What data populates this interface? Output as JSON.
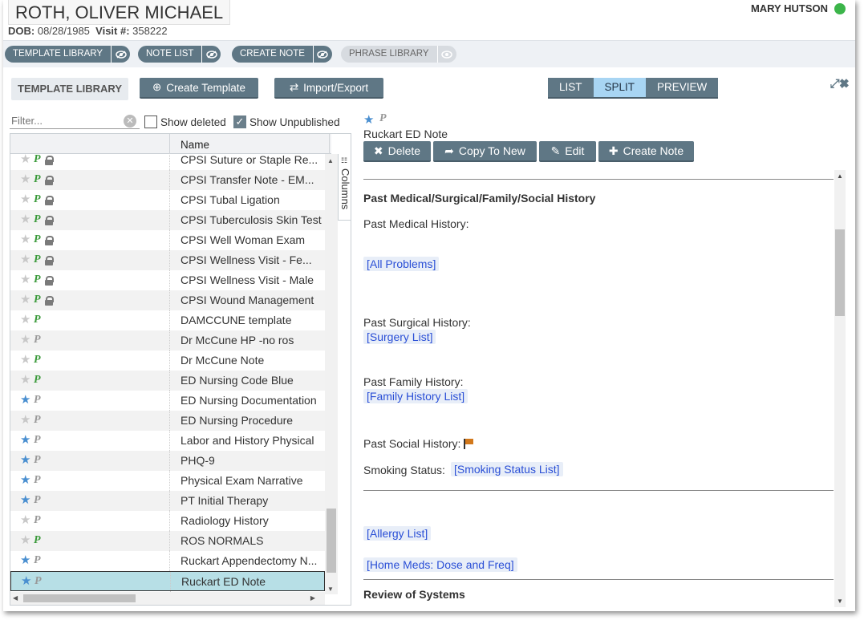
{
  "patient": {
    "name": "ROTH, OLIVER MICHAEL",
    "dob_label": "DOB:",
    "dob": "08/28/1985",
    "visit_label": "Visit #:",
    "visit": "358222"
  },
  "user": {
    "name": "MARY HUTSON",
    "status_color": "#3cb54a"
  },
  "nav_tabs": [
    {
      "label": "TEMPLATE LIBRARY",
      "enabled": true
    },
    {
      "label": "NOTE LIST",
      "enabled": true
    },
    {
      "label": "CREATE NOTE",
      "enabled": true
    },
    {
      "label": "PHRASE LIBRARY",
      "enabled": false
    }
  ],
  "toolbar": {
    "section_label": "TEMPLATE LIBRARY",
    "create_label": "Create Template",
    "import_label": "Import/Export",
    "views": [
      "LIST",
      "SPLIT",
      "PREVIEW"
    ],
    "active_view": "SPLIT"
  },
  "filter": {
    "placeholder": "Filter...",
    "show_deleted_label": "Show deleted",
    "show_deleted": false,
    "show_unpublished_label": "Show Unpublished",
    "show_unpublished": true
  },
  "grid": {
    "column_name": "Name",
    "columns_panel_label": "Columns",
    "rows": [
      {
        "name": "CPSI Suture or Staple Re...",
        "fav": false,
        "published": true,
        "locked": true
      },
      {
        "name": "CPSI Transfer Note - EM...",
        "fav": false,
        "published": true,
        "locked": true
      },
      {
        "name": "CPSI Tubal Ligation",
        "fav": false,
        "published": true,
        "locked": true
      },
      {
        "name": "CPSI Tuberculosis Skin Test",
        "fav": false,
        "published": true,
        "locked": true
      },
      {
        "name": "CPSI Well Woman Exam",
        "fav": false,
        "published": true,
        "locked": true
      },
      {
        "name": "CPSI Wellness Visit - Fe...",
        "fav": false,
        "published": true,
        "locked": true
      },
      {
        "name": "CPSI Wellness Visit - Male",
        "fav": false,
        "published": true,
        "locked": true
      },
      {
        "name": "CPSI Wound Management",
        "fav": false,
        "published": true,
        "locked": true
      },
      {
        "name": "DAMCCUNE template",
        "fav": false,
        "published": true,
        "locked": false
      },
      {
        "name": "Dr McCune HP -no ros",
        "fav": false,
        "published": false,
        "locked": false
      },
      {
        "name": "Dr McCune Note",
        "fav": false,
        "published": true,
        "locked": false
      },
      {
        "name": "ED Nursing Code Blue",
        "fav": false,
        "published": true,
        "locked": false
      },
      {
        "name": "ED Nursing Documentation",
        "fav": true,
        "published": false,
        "locked": false
      },
      {
        "name": "ED Nursing Procedure",
        "fav": false,
        "published": false,
        "locked": false
      },
      {
        "name": "Labor and History Physical",
        "fav": true,
        "published": false,
        "locked": false
      },
      {
        "name": "PHQ-9",
        "fav": true,
        "published": false,
        "locked": false
      },
      {
        "name": "Physical Exam Narrative",
        "fav": true,
        "published": false,
        "locked": false
      },
      {
        "name": "PT Initial Therapy",
        "fav": true,
        "published": false,
        "locked": false
      },
      {
        "name": "Radiology History",
        "fav": false,
        "published": false,
        "locked": false
      },
      {
        "name": "ROS NORMALS",
        "fav": false,
        "published": true,
        "locked": false
      },
      {
        "name": "Ruckart Appendectomy N...",
        "fav": true,
        "published": false,
        "locked": false
      },
      {
        "name": "Ruckart ED Note",
        "fav": true,
        "published": false,
        "locked": false,
        "selected": true
      }
    ]
  },
  "detail": {
    "badge": "P",
    "title": "Ruckart ED Note",
    "actions": [
      "Delete",
      "Copy To New",
      "Edit",
      "Create Note"
    ]
  },
  "preview": {
    "section1_title": "Past Medical/Surgical/Family/Social History",
    "pmh_label": "Past Medical History:",
    "pmh_tag": "[All Problems]",
    "psh_label": "Past Surgical History:",
    "psh_tag": "[Surgery List]",
    "pfh_label": "Past Family History:",
    "pfh_tag": "[Family History List]",
    "psoc_label": "Past Social History:",
    "smoking_label": "Smoking Status:",
    "smoking_tag": "[Smoking Status List]",
    "allergy_tag": "[Allergy List]",
    "meds_tag": "[Home Meds: Dose and Freq]",
    "section2_title": "Review of Systems"
  }
}
